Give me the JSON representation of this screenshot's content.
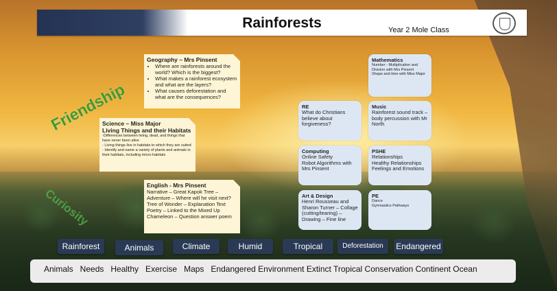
{
  "header": {
    "title": "Rainforests",
    "class_name": "Year 2 Mole Class"
  },
  "values_words": {
    "friendship": "Friendship",
    "curiosity": "Curiosity"
  },
  "geography": {
    "heading": "Geography – Mrs Pinsent",
    "bullets": [
      "Where are rainforests around the world? Which is the biggest?",
      "What makes a rainforest ecosystem and what are the layers?",
      "What causes deforestation and what are the consequences?"
    ]
  },
  "science": {
    "heading": "Science – Miss Major",
    "subheading": "Living Things and their Habitats",
    "lines": [
      "-Differences between living, dead, and things that have never been alive",
      "- Living things live in habitats to which they are suited",
      "- Identify and name a variety of plants and animals in their habitats, including micro-habitats"
    ]
  },
  "english": {
    "heading": "English - Mrs Pinsent",
    "lines": [
      "Narrative – Great Kapok Tree – Adventure – Where will he visit next?",
      "Tree of Wonder – Explanation Text",
      "Poetry – Linked to the Mixed Up Chameleon – Question answer poem"
    ]
  },
  "subjects": {
    "mathematics": {
      "heading": "Mathematics",
      "lines": [
        "Number - Multiplication and Division with Mrs Pinsent",
        "Shape and time with Miss Major"
      ]
    },
    "re": {
      "heading": "RE",
      "lines": [
        "What do Christians believe about forgiveness?"
      ]
    },
    "music": {
      "heading": "Music",
      "lines": [
        "Rainforest sound track – body percussion with Mr North"
      ]
    },
    "computing": {
      "heading": "Computing",
      "lines": [
        "Online Safety",
        "Robot Algorithms with Mrs Pinsent"
      ]
    },
    "pshe": {
      "heading": "PSHE",
      "lines": [
        "Relationships",
        "Healthy Relationships",
        "Feelings and Emotions"
      ]
    },
    "art": {
      "heading": "Art & Design",
      "lines": [
        "Henri Rousseau and Sharon Turner – Collage (cutting/tearing) – Drawing – Fine line"
      ]
    },
    "pe": {
      "heading": "PE",
      "lines": [
        "Dance",
        "Gymnastics Pathways"
      ]
    }
  },
  "topic_chips": [
    "Rainforest",
    "Animals",
    "Climate",
    "Humid",
    "Tropical",
    "Deforestation",
    "Endangered"
  ],
  "vocabulary": "Animals   Needs   Healthy   Exercise   Maps   Endangered Environment Extinct Tropical Conservation Continent Ocean",
  "colors": {
    "navy": "#2a3a55",
    "note": "#fdf5d6",
    "box": "#dde7f4",
    "values_green": "#3f9a34"
  }
}
